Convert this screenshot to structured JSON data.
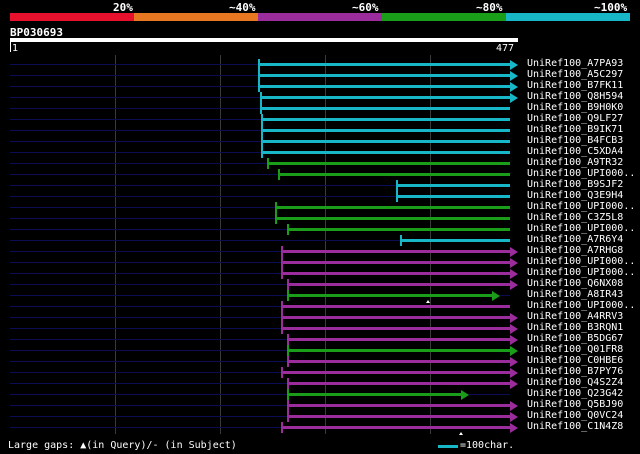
{
  "legend": {
    "labels": [
      "20%",
      "~40%",
      "~60%",
      "~80%",
      "~100%"
    ],
    "colors": [
      "#e8112d",
      "#e87722",
      "#9b2c9b",
      "#1a9e1a",
      "#17b7c8"
    ]
  },
  "query": {
    "id": "BP030693",
    "start": "1",
    "end": "477",
    "length": 477
  },
  "hits": [
    {
      "label": "UniRef100_A7PA93",
      "start": 237,
      "end": 477,
      "color": "#17b7c8",
      "arrow": true
    },
    {
      "label": "UniRef100_A5C297",
      "start": 237,
      "end": 477,
      "color": "#17b7c8",
      "arrow": true
    },
    {
      "label": "UniRef100_B7FK11",
      "start": 237,
      "end": 477,
      "color": "#17b7c8",
      "arrow": true
    },
    {
      "label": "UniRef100_Q8H594",
      "start": 239,
      "end": 477,
      "color": "#17b7c8",
      "arrow": true
    },
    {
      "label": "UniRef100_B9H0K0",
      "start": 239,
      "end": 477,
      "color": "#17b7c8",
      "arrow": false
    },
    {
      "label": "UniRef100_Q9LF27",
      "start": 240,
      "end": 477,
      "color": "#17b7c8",
      "arrow": false
    },
    {
      "label": "UniRef100_B9IK71",
      "start": 240,
      "end": 477,
      "color": "#17b7c8",
      "arrow": false
    },
    {
      "label": "UniRef100_B4FCB3",
      "start": 240,
      "end": 477,
      "color": "#17b7c8",
      "arrow": false
    },
    {
      "label": "UniRef100_C5XDA4",
      "start": 240,
      "end": 477,
      "color": "#17b7c8",
      "arrow": false
    },
    {
      "label": "UniRef100_A9TR32",
      "start": 246,
      "end": 477,
      "color": "#1a9e1a",
      "arrow": false
    },
    {
      "label": "UniRef100_UPI000..",
      "start": 256,
      "end": 477,
      "color": "#1a9e1a",
      "arrow": false
    },
    {
      "label": "UniRef100_B9SJF2",
      "start": 368,
      "end": 477,
      "color": "#17b7c8",
      "arrow": false
    },
    {
      "label": "UniRef100_Q3E9H4",
      "start": 368,
      "end": 477,
      "color": "#17b7c8",
      "arrow": false
    },
    {
      "label": "UniRef100_UPI000..",
      "start": 253,
      "end": 477,
      "color": "#1a9e1a",
      "arrow": false
    },
    {
      "label": "UniRef100_C3Z5L8",
      "start": 253,
      "end": 477,
      "color": "#1a9e1a",
      "arrow": false
    },
    {
      "label": "UniRef100_UPI000..",
      "start": 265,
      "end": 477,
      "color": "#1a9e1a",
      "arrow": false
    },
    {
      "label": "UniRef100_A7R6Y4",
      "start": 372,
      "end": 477,
      "color": "#17b7c8",
      "arrow": false
    },
    {
      "label": "UniRef100_A7RHG8",
      "start": 259,
      "end": 477,
      "color": "#9b2c9b",
      "arrow": true
    },
    {
      "label": "UniRef100_UPI000..",
      "start": 259,
      "end": 477,
      "color": "#9b2c9b",
      "arrow": true
    },
    {
      "label": "UniRef100_UPI000..",
      "start": 259,
      "end": 477,
      "color": "#9b2c9b",
      "arrow": true
    },
    {
      "label": "UniRef100_Q6NX08",
      "start": 265,
      "end": 477,
      "color": "#9b2c9b",
      "arrow": true
    },
    {
      "label": "UniRef100_A8IR43",
      "start": 265,
      "end": 460,
      "color": "#1a9e1a",
      "arrow": true,
      "gap_at": 399
    },
    {
      "label": "UniRef100_UPI000..",
      "start": 259,
      "end": 477,
      "color": "#9b2c9b",
      "arrow": false
    },
    {
      "label": "UniRef100_A4RRV3",
      "start": 259,
      "end": 477,
      "color": "#9b2c9b",
      "arrow": true
    },
    {
      "label": "UniRef100_B3RQN1",
      "start": 259,
      "end": 477,
      "color": "#9b2c9b",
      "arrow": true
    },
    {
      "label": "UniRef100_B5DG67",
      "start": 265,
      "end": 477,
      "color": "#9b2c9b",
      "arrow": true
    },
    {
      "label": "UniRef100_Q01FR8",
      "start": 265,
      "end": 477,
      "color": "#1a9e1a",
      "arrow": true
    },
    {
      "label": "UniRef100_C0HBE6",
      "start": 265,
      "end": 477,
      "color": "#9b2c9b",
      "arrow": true
    },
    {
      "label": "UniRef100_B7PY76",
      "start": 259,
      "end": 477,
      "color": "#9b2c9b",
      "arrow": true
    },
    {
      "label": "UniRef100_Q4S2Z4",
      "start": 265,
      "end": 477,
      "color": "#9b2c9b",
      "arrow": true
    },
    {
      "label": "UniRef100_Q23G42",
      "start": 265,
      "end": 430,
      "color": "#1a9e1a",
      "arrow": true
    },
    {
      "label": "UniRef100_Q5BJ90",
      "start": 265,
      "end": 477,
      "color": "#9b2c9b",
      "arrow": true
    },
    {
      "label": "UniRef100_Q0VC24",
      "start": 265,
      "end": 477,
      "color": "#9b2c9b",
      "arrow": true
    },
    {
      "label": "UniRef100_C1N4Z8",
      "start": 259,
      "end": 477,
      "color": "#9b2c9b",
      "arrow": true,
      "gap_at": 430
    }
  ],
  "footer": {
    "gap_text": "Large gaps: ▲(in Query)/- (in Subject)",
    "scale_text": "=100char.",
    "scale_color": "#17b7c8"
  }
}
